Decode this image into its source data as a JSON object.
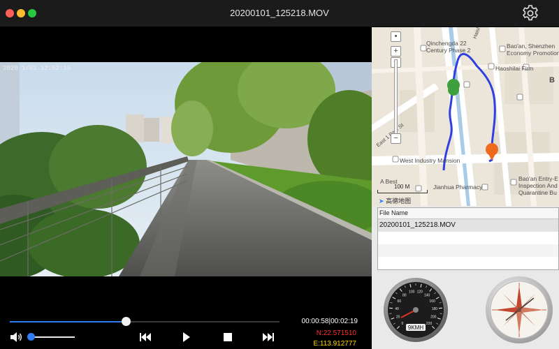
{
  "window": {
    "title": "20200101_125218.MOV"
  },
  "video": {
    "osd_text": "2020  1/01  12:52:18"
  },
  "playback": {
    "current_time": "00:00:58",
    "total_time": "00:02:19",
    "time_separator": "|",
    "progress_fraction": 0.43,
    "volume_fraction": 0.06,
    "latitude": "N:22.571510",
    "longitude": "E:113.912777"
  },
  "map": {
    "labels": {
      "building": "Qinchengda 22\nCentury Phase 2",
      "haishi": "Haishi",
      "economy": "Bao'an, Shenzhen\nEconomy Promotion",
      "haoshilai": "Haoshilai Firm",
      "east": "East 1 Park St",
      "west_industry": "West Industry Mansion",
      "a_best": "A Best",
      "jianhua": "Jianhua Pharmacy",
      "entry": "Bao'an Entry-E\nInspection And\nQuarantine Bu",
      "b_letter": "B"
    },
    "scale_label": "100 M",
    "logo": "高德地图",
    "start_marker": "S",
    "end_marker": "E"
  },
  "file_list": {
    "header": "File Name",
    "rows": [
      "20200101_125218.MOV"
    ]
  },
  "speedometer": {
    "readout": "9KMH",
    "tick_labels": [
      "0",
      "20",
      "40",
      "60",
      "80",
      "100",
      "120",
      "140",
      "160",
      "180",
      "200",
      "220"
    ]
  },
  "colors": {
    "accent": "#2f7cf6",
    "latitude": "#ff2f2f",
    "longitude": "#ffd800",
    "route": "#2f3fe0",
    "start_pin": "#3da03d",
    "end_pin": "#f06a1e"
  }
}
